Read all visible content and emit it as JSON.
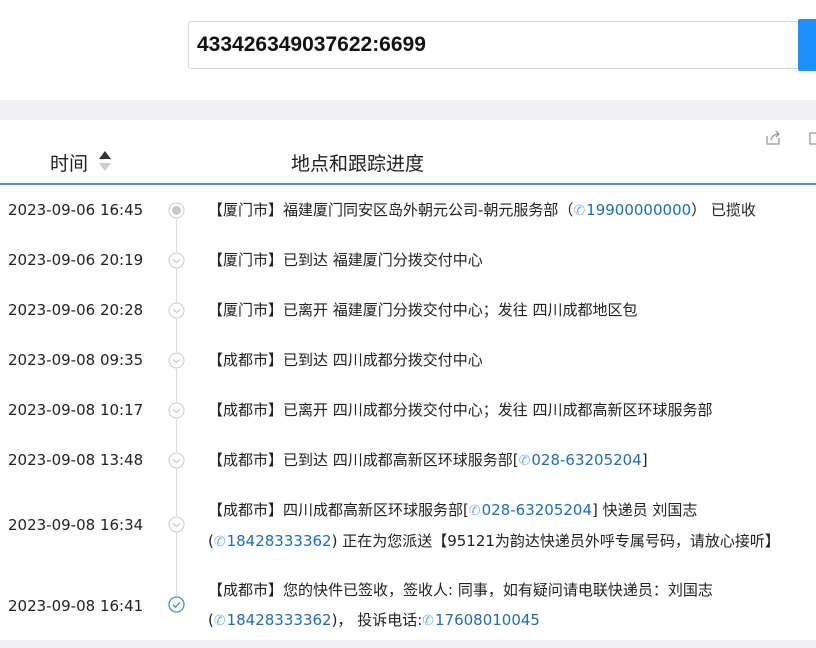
{
  "search": {
    "value": "433426349037622:6699"
  },
  "header": {
    "time_label": "时间",
    "location_label": "地点和跟踪进度"
  },
  "events": [
    {
      "time": "2023-09-06 16:45",
      "city": "【厦门市】",
      "text": "福建厦门同安区岛外朝元公司-朝元服务部（",
      "phone": "19900000000",
      "after": "） 已揽收",
      "status": "collected"
    },
    {
      "time": "2023-09-06 20:19",
      "city": "【厦门市】",
      "text": "已到达 福建厦门分拨交付中心",
      "status": "transit"
    },
    {
      "time": "2023-09-06 20:28",
      "city": "【厦门市】",
      "text": "已离开 福建厦门分拨交付中心；发往 四川成都地区包",
      "status": "transit"
    },
    {
      "time": "2023-09-08 09:35",
      "city": "【成都市】",
      "text": "已到达 四川成都分拨交付中心",
      "status": "transit"
    },
    {
      "time": "2023-09-08 10:17",
      "city": "【成都市】",
      "text": "已离开 四川成都分拨交付中心；发往 四川成都高新区环球服务部",
      "status": "transit"
    },
    {
      "time": "2023-09-08 13:48",
      "city": "【成都市】",
      "text": "已到达 四川成都高新区环球服务部[",
      "phone": "028-63205204",
      "after": "]",
      "status": "transit"
    },
    {
      "time": "2023-09-08 16:34",
      "city": "【成都市】",
      "text": "四川成都高新区环球服务部[",
      "phone": "028-63205204",
      "after": "] 快递员 刘国志",
      "line2_pre": "(",
      "phone2": "18428333362",
      "line2_after": ") 正在为您派送【95121为韵达快递员外呼专属号码，请放心接听】",
      "status": "delivering"
    },
    {
      "time": "2023-09-08 16:41",
      "city": "【成都市】",
      "text": "您的快件已签收，签收人: 同事，如有疑问请电联快递员：刘国志",
      "line2_pre": "(",
      "phone2": "18428333362",
      "line2_after": ")， 投诉电话:",
      "phone3": "17608010045",
      "status": "signed"
    }
  ],
  "colors": {
    "accent": "#1890ff",
    "phone": "#1a6fb5",
    "header_line": "#4a90e2",
    "band": "#f0f0f2"
  }
}
